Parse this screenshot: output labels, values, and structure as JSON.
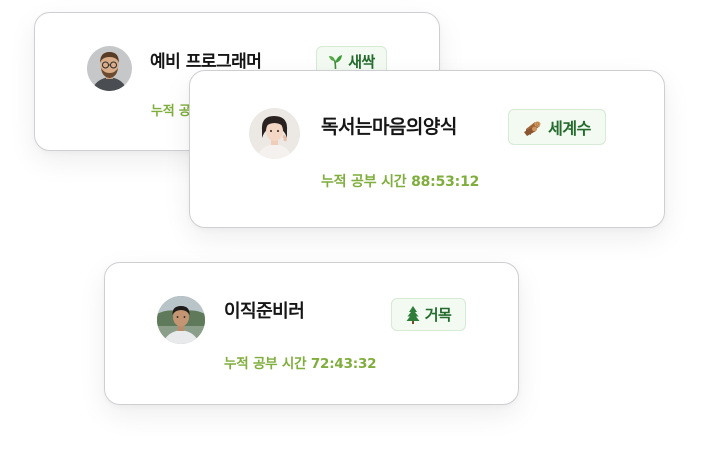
{
  "cards": [
    {
      "name": "예비 프로그래머",
      "badge": {
        "label": "새싹",
        "icon": "sprout-icon"
      },
      "study_time": "누적 공부 시간"
    },
    {
      "name": "독서는마음의양식",
      "badge": {
        "label": "세계수",
        "icon": "wood-log-icon"
      },
      "study_time": "누적 공부 시간 88:53:12"
    },
    {
      "name": "이직준비러",
      "badge": {
        "label": "거목",
        "icon": "pine-tree-icon"
      },
      "study_time": "누적 공부 시간 72:43:32"
    }
  ],
  "colors": {
    "time_text": "#7fae3c",
    "badge_text": "#256b2e",
    "badge_bg": "#f2faf2",
    "card_border": "#cfcfd3"
  }
}
